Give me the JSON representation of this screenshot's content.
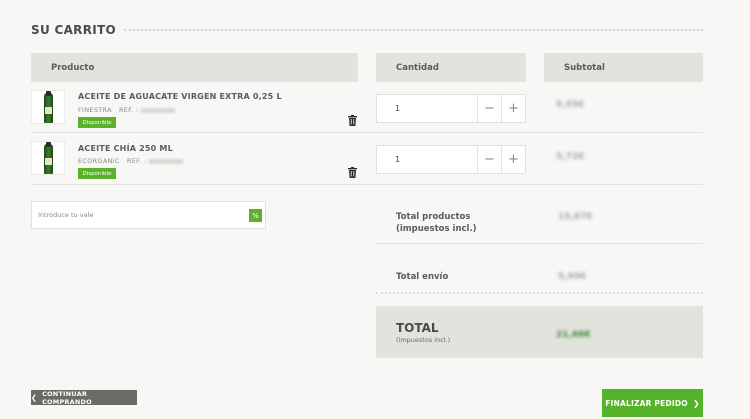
{
  "cart": {
    "title": "SU CARRITO",
    "headers": {
      "product": "Producto",
      "quantity": "Cantidad",
      "subtotal": "Subtotal"
    },
    "items": [
      {
        "name": "ACEITE DE AGUACATE VIRGEN EXTRA 0,25 L",
        "brand": "FINESTRA",
        "ref_label": "REF. :",
        "badge": "Disponible",
        "quantity": "1",
        "subtotal": "9,95€"
      },
      {
        "name": "ACEITE CHÍA 250 ML",
        "brand": "ECORGANIC",
        "ref_label": "REF. :",
        "badge": "Disponible",
        "quantity": "1",
        "subtotal": "5,72€"
      }
    ],
    "qty_minus": "−",
    "qty_plus": "+",
    "voucher": {
      "placeholder": "Introduce tu vale",
      "button": "%"
    },
    "totals": {
      "products_label": "Total productos (impuestos incl.)",
      "products_value": "15,67€",
      "shipping_label": "Total envío",
      "shipping_value": "5,99€",
      "total_label": "TOTAL",
      "total_sub": "(impuestos incl.)",
      "total_value": "21,66€"
    },
    "buttons": {
      "continue": "CONTINUAR COMPRANDO",
      "finish": "FINALIZAR PEDIDO"
    }
  },
  "colors": {
    "accent_green": "#55b32a",
    "header_bg": "#e3e3de",
    "dark_button": "#6b6b66"
  }
}
